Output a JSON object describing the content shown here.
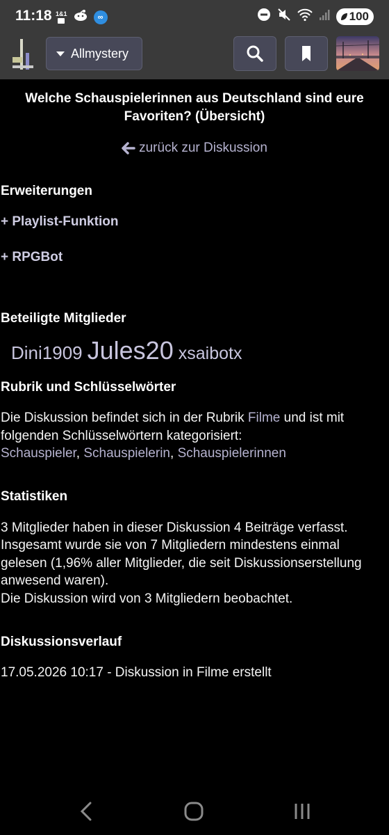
{
  "status_bar": {
    "time": "11:18",
    "carrier_icon_text": "1&1",
    "battery": "100"
  },
  "toolbar": {
    "forum_label": "Allmystery"
  },
  "page": {
    "title": "Welche Schauspielerinnen aus Deutschland sind eure Favoriten? (Übersicht)",
    "back_link": "zurück zur Diskussion"
  },
  "extensions": {
    "heading": "Erweiterungen",
    "items": [
      "+ Playlist-Funktion",
      "+ RPGBot"
    ]
  },
  "members": {
    "heading": "Beteiligte Mitglieder",
    "names": [
      "Dini1909",
      "Jules20",
      "xsaibotx"
    ]
  },
  "category": {
    "heading": "Rubrik und Schlüsselwörter",
    "text_before": "Die Diskussion befindet sich in der Rubrik ",
    "category_link": "Filme",
    "text_after": " und ist mit folgenden Schlüsselwörtern kategorisiert:",
    "keywords": [
      "Schauspieler",
      "Schauspielerin",
      "Schauspielerinnen"
    ],
    "keyword_separator": ", "
  },
  "statistics": {
    "heading": "Statistiken",
    "lines": [
      "3 Mitglieder haben in dieser Diskussion 4 Beiträge verfasst.",
      "Insgesamt wurde sie von 7 Mitgliedern mindestens einmal gelesen (1,96% aller Mitglieder, die seit Diskussionserstellung anwesend waren).",
      "Die Diskussion wird von 3 Mitgliedern beobachtet."
    ]
  },
  "history": {
    "heading": "Diskussionsverlauf",
    "entry": "17.05.2026 10:17 - Diskussion in Filme erstellt"
  },
  "colors": {
    "background": "#000000",
    "bar": "#3a3a3a",
    "button": "#474858",
    "link": "#b6b3d0"
  }
}
